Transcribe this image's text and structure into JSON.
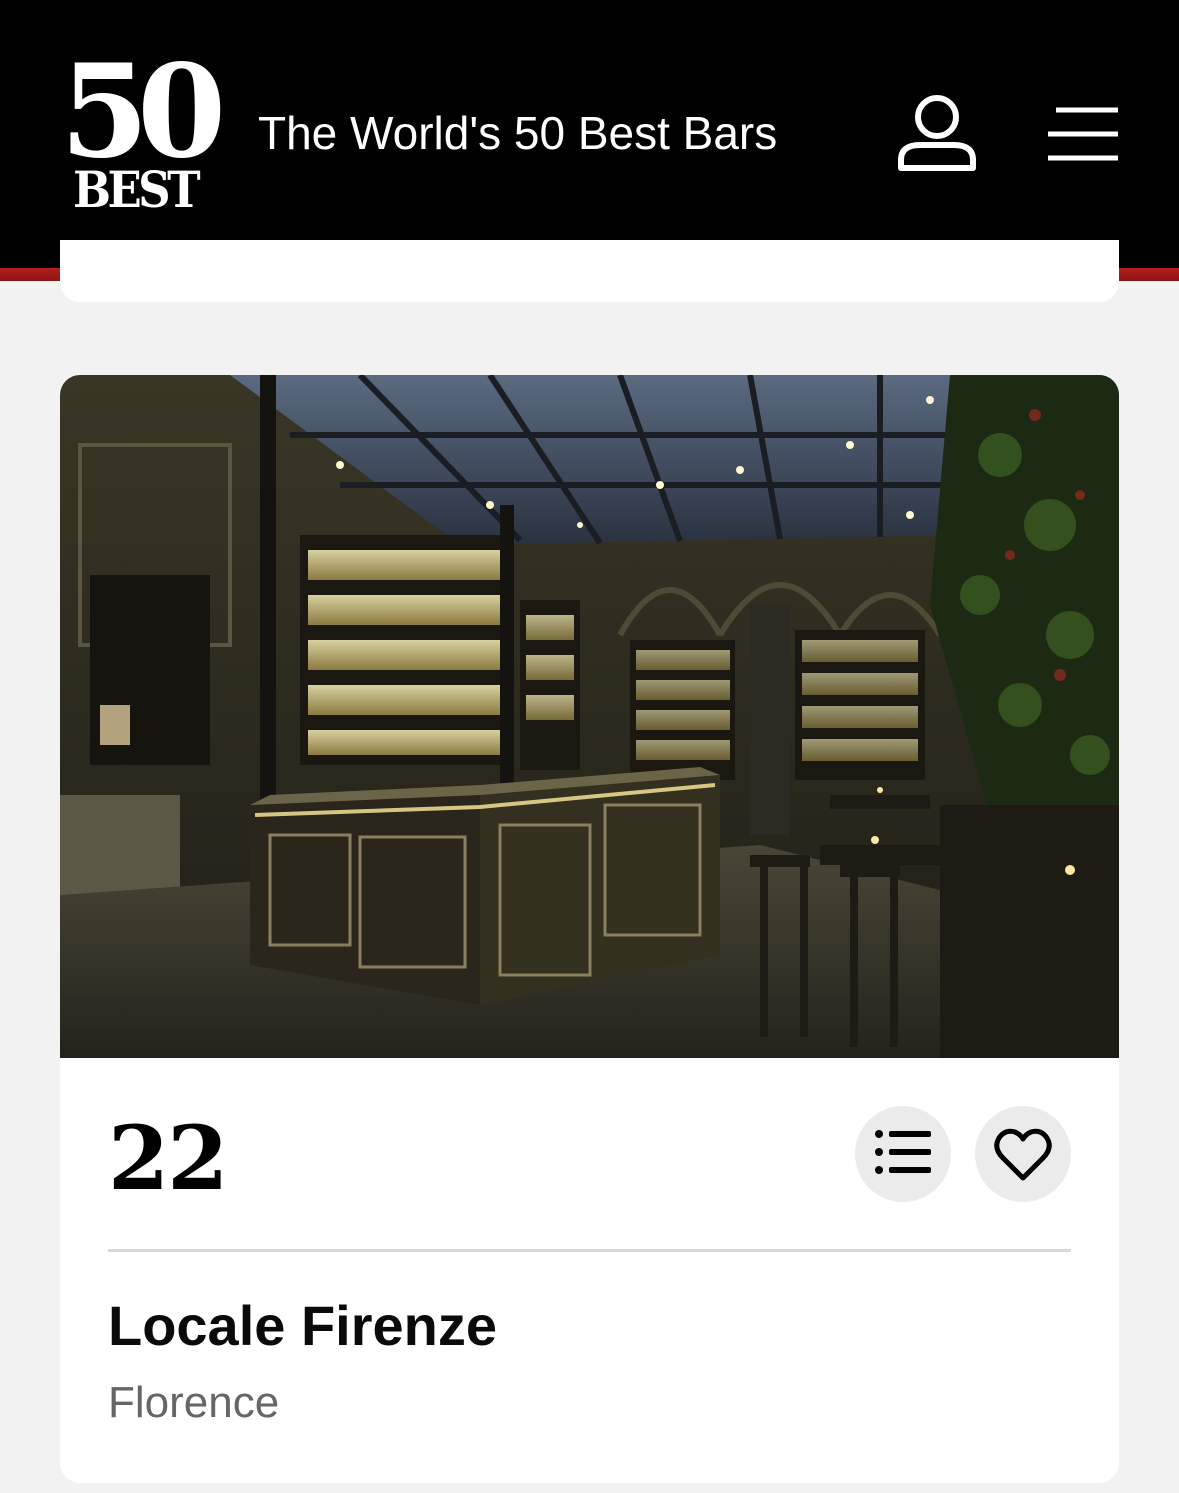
{
  "header": {
    "logo": {
      "number": "50",
      "word": "BEST"
    },
    "title": "The World's 50 Best Bars",
    "user_icon": "user-icon",
    "menu_icon": "hamburger-menu-icon"
  },
  "colors": {
    "header_bg": "#000000",
    "accent": "#a51b1b",
    "page_bg": "#f2f2f2",
    "card_bg": "#ffffff",
    "button_bg": "#ebebeb"
  },
  "bar": {
    "rank": "22",
    "name": "Locale Firenze",
    "city": "Florence",
    "list_icon": "list-icon",
    "favourite_icon": "heart-icon",
    "photo_alt": "Interior of Locale Firenze bar"
  }
}
